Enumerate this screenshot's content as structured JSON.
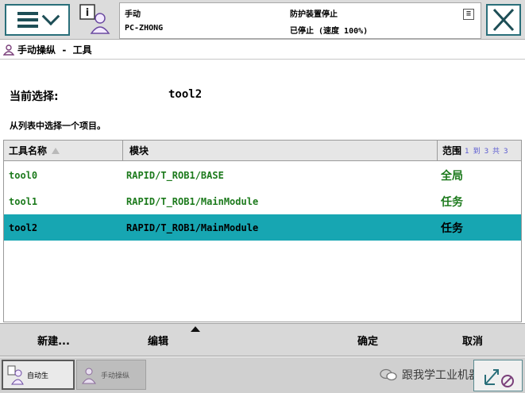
{
  "header": {
    "status": {
      "mode": "手动",
      "host": "PC-ZHONG",
      "guard": "防护装置停止",
      "run_state": "已停止 (速度 100%)"
    }
  },
  "breadcrumb": {
    "title": "手动操纵 - 工具"
  },
  "selection": {
    "label": "当前选择:",
    "value": "tool2",
    "instruction": "从列表中选择一个项目。"
  },
  "table": {
    "columns": {
      "name": "工具名称",
      "module": "模块",
      "scope": "范围"
    },
    "pager": "1 到 3 共 3",
    "rows": [
      {
        "name": "tool0",
        "module": "RAPID/T_ROB1/BASE",
        "scope": "全局"
      },
      {
        "name": "tool1",
        "module": "RAPID/T_ROB1/MainModule",
        "scope": "任务"
      },
      {
        "name": "tool2",
        "module": "RAPID/T_ROB1/MainModule",
        "scope": "任务"
      }
    ],
    "selected_index": 2
  },
  "commands": {
    "new": "新建...",
    "edit": "编辑",
    "ok": "确定",
    "cancel": "取消"
  },
  "taskbar": {
    "auto": "自动生",
    "jog": "手动操纵"
  },
  "watermark": "跟我学工业机器人",
  "colors": {
    "accent": "#17a6b2",
    "frame": "#2a6f7a",
    "row_text": "#1c7a1c"
  }
}
